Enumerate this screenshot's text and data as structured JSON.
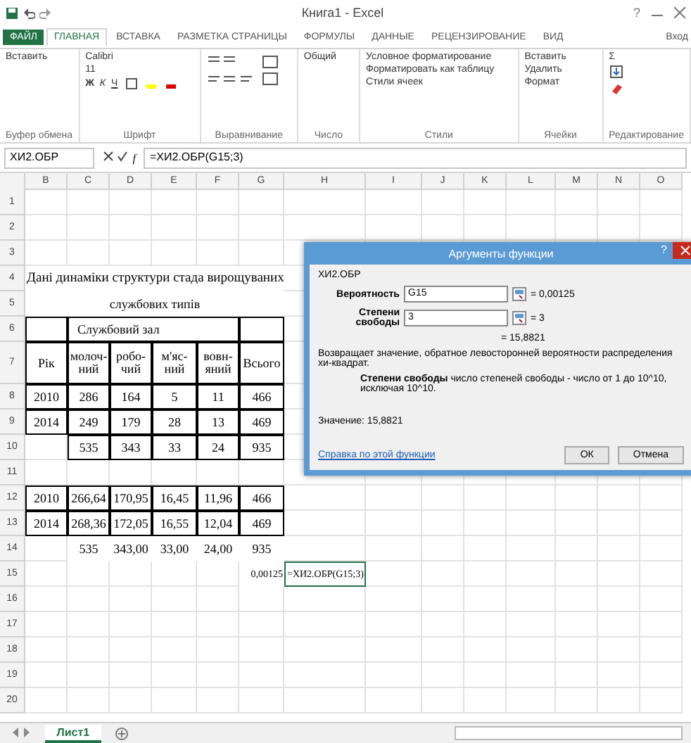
{
  "window": {
    "title": "Книга1 - Excel"
  },
  "ribbon": {
    "tabs": [
      {
        "label": "ФАЙЛ",
        "selected": false,
        "kind": "file"
      },
      {
        "label": "ГЛАВНАЯ",
        "selected": true,
        "kind": "tab"
      },
      {
        "label": "ВСТАВКА",
        "selected": false,
        "kind": "tab"
      },
      {
        "label": "РАЗМЕТКА СТРАНИЦЫ",
        "selected": false,
        "kind": "tab"
      },
      {
        "label": "ФОРМУЛЫ",
        "selected": false,
        "kind": "tab"
      },
      {
        "label": "ДАННЫЕ",
        "selected": false,
        "kind": "tab"
      },
      {
        "label": "РЕЦЕНЗИРОВАНИЕ",
        "selected": false,
        "kind": "tab"
      },
      {
        "label": "ВИД",
        "selected": false,
        "kind": "tab"
      }
    ],
    "account": "Вход",
    "groups": [
      {
        "label": "Буфер обмена",
        "commands": [
          "Вставить"
        ]
      },
      {
        "label": "Шрифт",
        "commands": [
          "Calibri",
          "11"
        ]
      },
      {
        "label": "Выравнивание"
      },
      {
        "label": "Число",
        "commands": [
          "Общий"
        ]
      },
      {
        "label": "Стили",
        "commands": [
          "Условное форматирование",
          "Форматировать как таблицу",
          "Стили ячеек"
        ]
      },
      {
        "label": "Ячейки",
        "commands": [
          "Вставить",
          "Удалить",
          "Формат"
        ]
      },
      {
        "label": "Редактирование",
        "commands": [
          "Σ"
        ]
      }
    ],
    "font_buttons": [
      "Ж",
      "К",
      "Ч"
    ],
    "help": "?"
  },
  "formula_bar": {
    "name_box": "ХИ2.ОБР",
    "fx": "f",
    "formula": "=ХИ2.ОБР(G15;3)"
  },
  "sheet": {
    "columns": [
      "B",
      "C",
      "D",
      "E",
      "F",
      "G",
      "H",
      "I",
      "J",
      "K",
      "L",
      "M",
      "N",
      "O"
    ],
    "rows": [
      {
        "header": "1",
        "kind": "plain",
        "cells": []
      },
      {
        "header": "2",
        "kind": "plain",
        "cells": []
      },
      {
        "header": "3",
        "kind": "plain",
        "cells": []
      },
      {
        "header": "4",
        "kind": "title",
        "cells": [
          "Дані динаміки структури стада вирощуваних"
        ]
      },
      {
        "header": "5",
        "kind": "subtitle",
        "cells": [
          "службових типів"
        ]
      },
      {
        "header": "6",
        "kind": "group",
        "cells": [
          null,
          "Службовий зал",
          null
        ]
      },
      {
        "header": "7",
        "kind": "head",
        "cells": [
          "Рік",
          "молоч-ний",
          "робо-чий",
          "м'яс-ний",
          "вовн-яний",
          "Всього"
        ]
      },
      {
        "header": "8",
        "kind": "table",
        "cells": [
          "2010",
          "286",
          "164",
          "5",
          "11",
          "466"
        ]
      },
      {
        "header": "9",
        "kind": "table",
        "cells": [
          "2014",
          "249",
          "179",
          "28",
          "13",
          "469"
        ]
      },
      {
        "header": "10",
        "kind": "table",
        "cells": [
          null,
          "535",
          "343",
          "33",
          "24",
          "935"
        ]
      },
      {
        "header": "11",
        "kind": "plain",
        "cells": []
      },
      {
        "header": "12",
        "kind": "table",
        "cells": [
          "2010",
          "266,64",
          "170,95",
          "16,45",
          "11,96",
          "466"
        ]
      },
      {
        "header": "13",
        "kind": "table",
        "cells": [
          "2014",
          "268,36",
          "172,05",
          "16,55",
          "12,04",
          "469"
        ]
      },
      {
        "header": "14",
        "kind": "plain",
        "cells": [
          null,
          "535",
          "343,00",
          "33,00",
          "24,00",
          "935"
        ]
      },
      {
        "header": "15",
        "kind": "result",
        "cells": [
          null,
          null,
          null,
          null,
          null,
          "0,00125",
          "=ХИ2.ОБР(G15;3)"
        ]
      },
      {
        "header": "16",
        "kind": "plain",
        "cells": []
      },
      {
        "header": "17",
        "kind": "plain",
        "cells": []
      },
      {
        "header": "18",
        "kind": "plain",
        "cells": []
      },
      {
        "header": "19",
        "kind": "plain",
        "cells": []
      },
      {
        "header": "20",
        "kind": "plain",
        "cells": []
      }
    ]
  },
  "sheet_tabs": [
    {
      "label": "Лист1",
      "selected": true
    }
  ],
  "dialog": {
    "title": "Аргументы функции",
    "help": "?",
    "function": "ХИ2.ОБР",
    "args": [
      {
        "label": "Вероятность",
        "value": "G15",
        "result": "= 0,00125"
      },
      {
        "label": "Степени свободы",
        "value": "3",
        "result": "= 3"
      }
    ],
    "result": "= 15,8821",
    "description": "Возвращает значение, обратное левосторонней вероятности распределения хи-квадрат.",
    "arg_help_label": "Степени свободы",
    "arg_help": "число степеней свободы - число от 1 до 10^10, исключая 10^10.",
    "value_line": "Значение: 15,8821",
    "help_link": "Справка по этой функции",
    "buttons": [
      "ОК",
      "Отмена"
    ]
  }
}
